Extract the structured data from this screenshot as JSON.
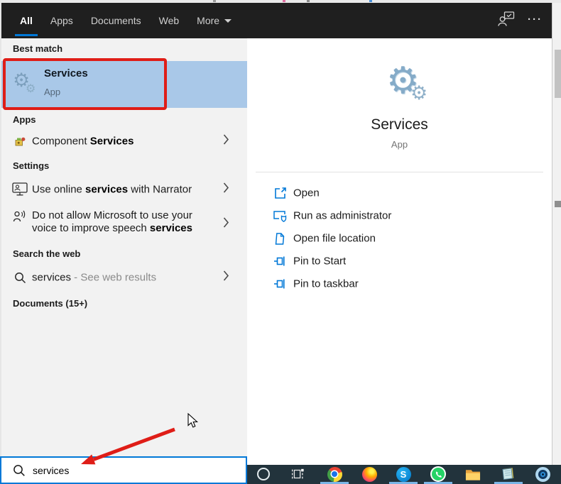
{
  "topbar": {
    "tabs": [
      {
        "label": "All",
        "active": true
      },
      {
        "label": "Apps",
        "active": false
      },
      {
        "label": "Documents",
        "active": false
      },
      {
        "label": "Web",
        "active": false
      },
      {
        "label": "More",
        "active": false,
        "dropdown": true
      }
    ],
    "ellipsis": "···"
  },
  "left": {
    "best_match_header": "Best match",
    "best_match_title": "Services",
    "best_match_subtitle": "App",
    "apps_header": "Apps",
    "component_pre": "Component ",
    "component_bold": "Services",
    "settings_header": "Settings",
    "narrator_pre": "Use online ",
    "narrator_bold": "services",
    "narrator_post": " with Narrator",
    "speech_pre": "Do not allow Microsoft to use your voice to improve speech ",
    "speech_bold": "services",
    "search_web_header": "Search the web",
    "web_query": "services",
    "web_suffix": " - See web results",
    "documents_header": "Documents (15+)"
  },
  "right": {
    "app_title": "Services",
    "app_subtitle": "App",
    "actions": [
      "Open",
      "Run as administrator",
      "Open file location",
      "Pin to Start",
      "Pin to taskbar"
    ]
  },
  "search_box": {
    "value": "services"
  },
  "taskbar": {
    "items": [
      "cortana",
      "task-view",
      "chrome",
      "firefox",
      "skype",
      "whatsapp",
      "file-explorer",
      "notepad",
      "recorder"
    ],
    "running": [
      "chrome",
      "skype",
      "whatsapp",
      "notepad"
    ],
    "skype_letter": "S"
  },
  "colors": {
    "accent_blue": "#0078d7",
    "best_match_highlight": "#a9c8e8",
    "annotation_red": "#df1d17",
    "topbar_bg": "#1f1f1f",
    "taskbar_bg": "#22333c",
    "left_panel_bg": "#f2f2f2"
  }
}
